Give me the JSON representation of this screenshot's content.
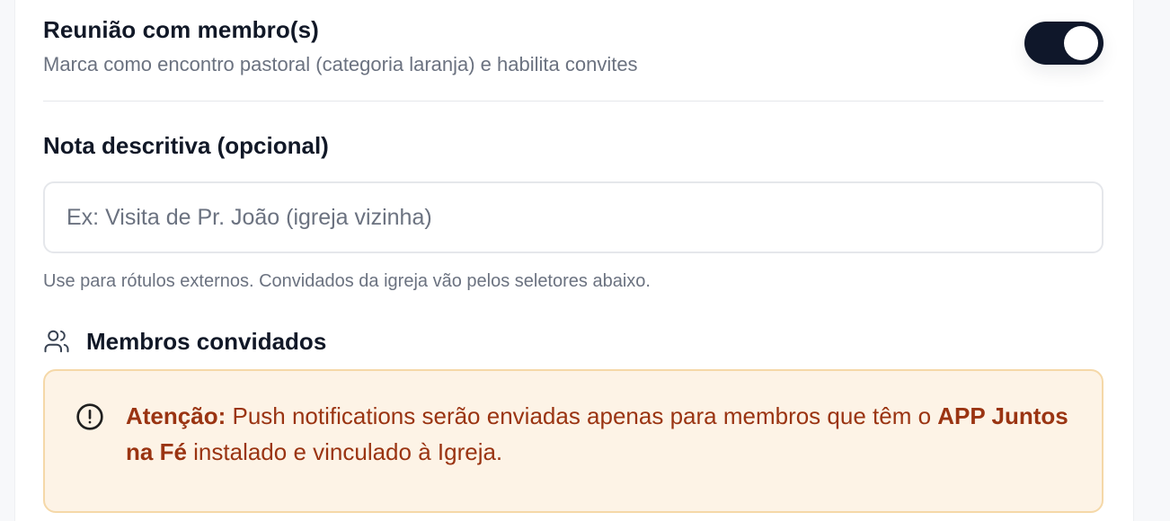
{
  "meeting_toggle": {
    "title": "Reunião com membro(s)",
    "description": "Marca como encontro pastoral (categoria laranja) e habilita convites",
    "state": "on"
  },
  "note_field": {
    "label": "Nota descritiva (opcional)",
    "value": "",
    "placeholder": "Ex: Visita de Pr. João (igreja vizinha)",
    "helper": "Use para rótulos externos. Convidados da igreja vão pelos seletores abaixo."
  },
  "members": {
    "icon": "users-icon",
    "title": "Membros convidados"
  },
  "alert": {
    "icon": "alert-circle-icon",
    "prefix": "Atenção:",
    "text_1": " Push notifications serão enviadas apenas para membros que têm o ",
    "app_name": "APP Juntos na Fé",
    "text_2": " instalado e vinculado à Igreja."
  },
  "colors": {
    "toggle_on": "#0f172a",
    "alert_bg": "#fdf3e6",
    "alert_border": "#f5d8a8",
    "alert_text": "#9a3412"
  }
}
